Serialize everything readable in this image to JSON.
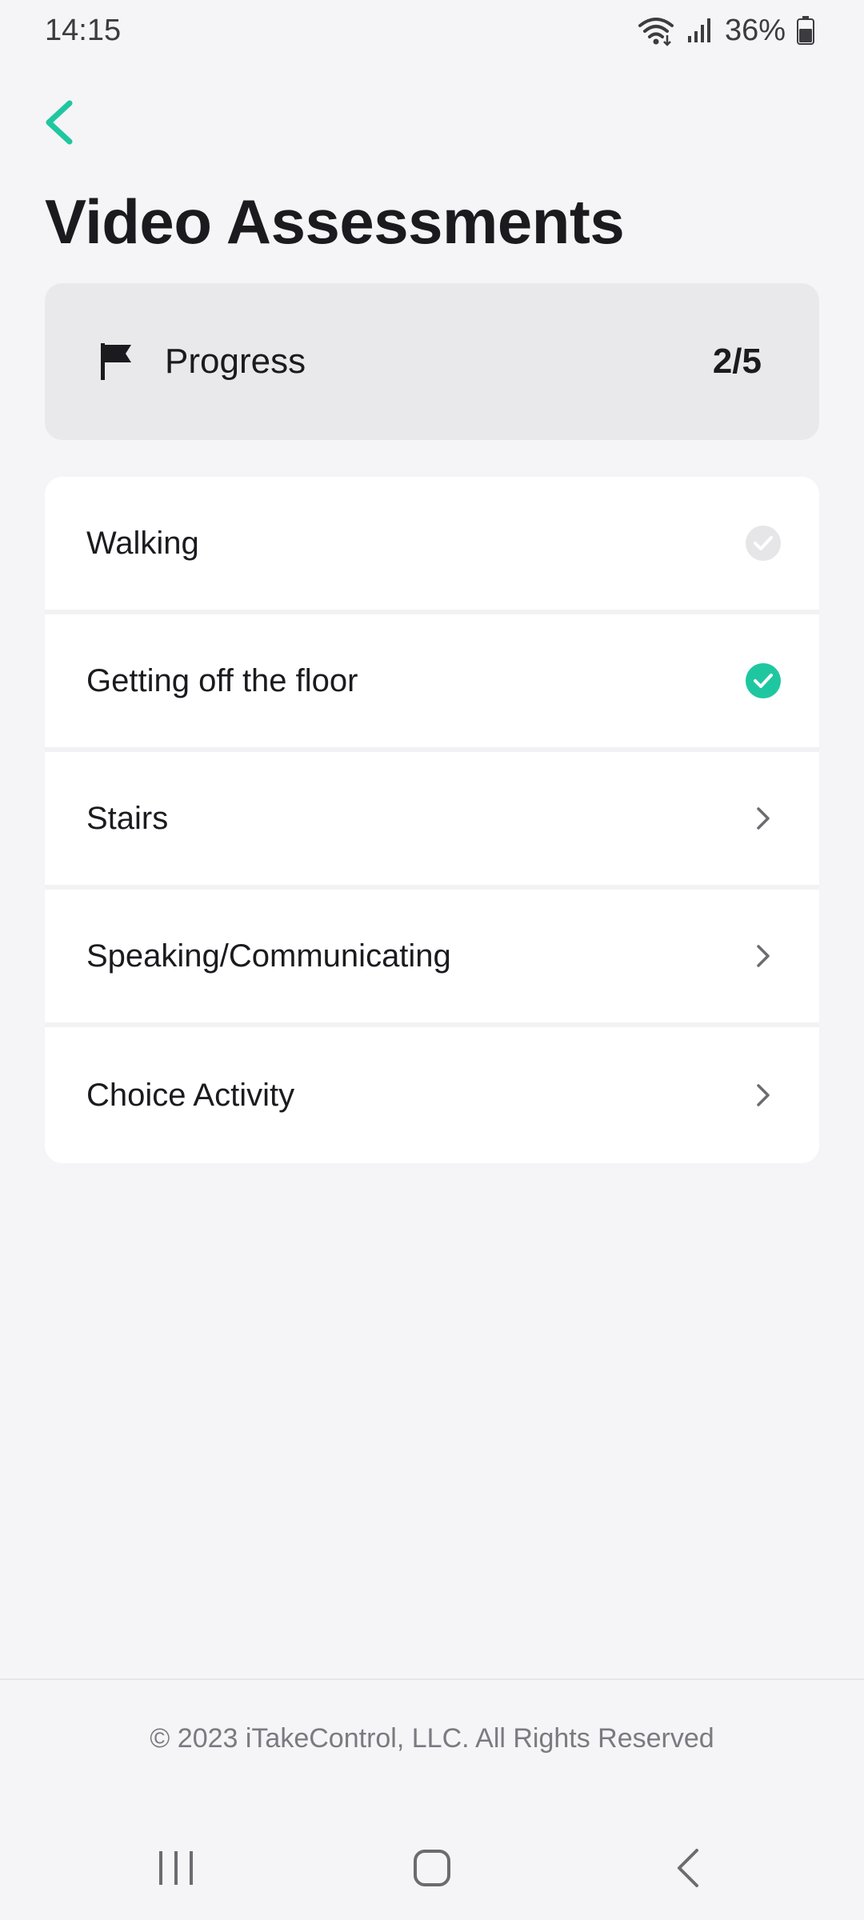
{
  "status_bar": {
    "time": "14:15",
    "battery": "36%",
    "icons": [
      "wifi-icon",
      "signal-icon",
      "battery-icon"
    ]
  },
  "header": {
    "back_icon": "chevron-left-icon",
    "title": "Video Assessments"
  },
  "progress": {
    "icon": "flag-icon",
    "label": "Progress",
    "count": "2/5"
  },
  "assessments": {
    "items": [
      {
        "label": "Walking",
        "state": "completed-pending",
        "icon": "check-circle-gray-icon"
      },
      {
        "label": "Getting off the floor",
        "state": "completed",
        "icon": "check-circle-green-icon"
      },
      {
        "label": "Stairs",
        "state": "open",
        "icon": "chevron-right-icon"
      },
      {
        "label": "Speaking/Communicating",
        "state": "open",
        "icon": "chevron-right-icon"
      },
      {
        "label": "Choice Activity",
        "state": "open",
        "icon": "chevron-right-icon"
      }
    ]
  },
  "footer": {
    "copyright": "© 2023 iTakeControl, LLC. All Rights Reserved"
  },
  "nav_bar": {
    "buttons": [
      "recent-apps-icon",
      "home-icon",
      "back-icon"
    ]
  },
  "colors": {
    "accent": "#1fc7a0",
    "background": "#f5f4f7",
    "card": "#ffffff",
    "progress_card": "#e9e9ec",
    "muted_check": "#e6e6e8"
  }
}
